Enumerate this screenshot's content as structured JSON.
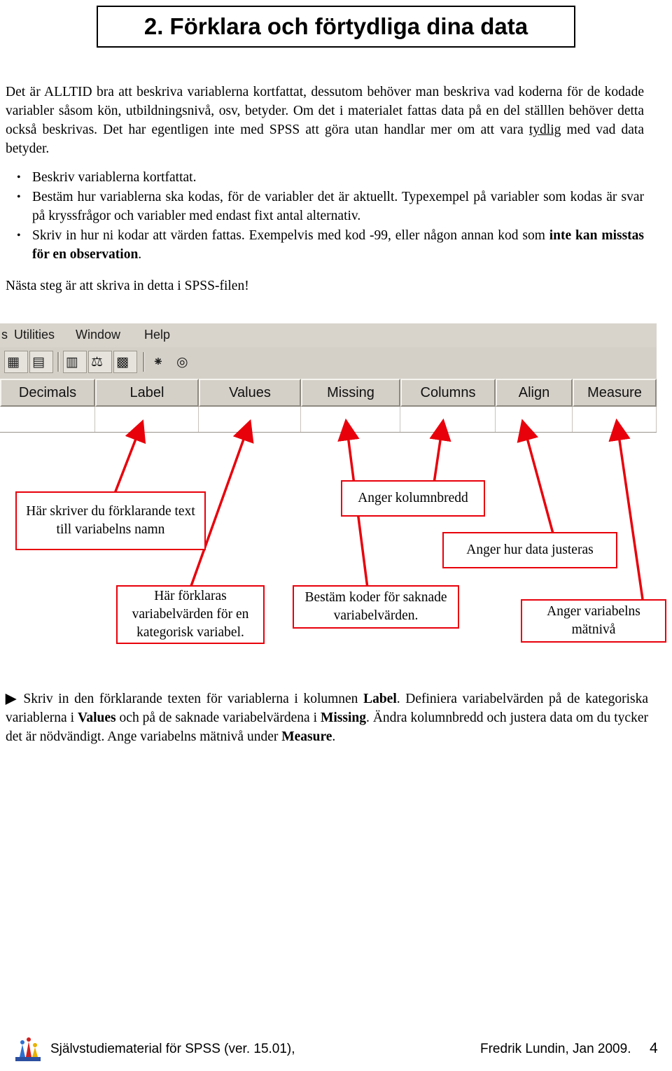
{
  "document": {
    "title": "2. Förklara och förtydliga dina data",
    "intro_html": "Det är ALLTID bra att beskriva variablerna kortfattat, dessutom behöver man beskriva vad koderna för de kodade variabler såsom kön, utbildningsnivå, osv, betyder. Om det i materialet fattas data på en del ställlen behöver detta också beskrivas. Det har egentligen inte med SPSS att göra utan handlar mer om att vara <u>tydlig</u> med vad data betyder.",
    "bullets": [
      "Beskriv variablerna kortfattat.",
      "Bestäm hur variablerna ska kodas, för de variabler det är aktuellt. Typexempel på variabler som kodas är svar på kryssfrågor och variabler med endast fixt antal alternativ.",
      "Skriv in hur ni kodar att värden fattas. Exempelvis med kod -99, eller någon annan kod som <b>inte kan misstas för en observation</b>."
    ],
    "next_step": "Nästa steg är att skriva in detta i SPSS-filen!",
    "instruction_html": "<b>▶</b> Skriv in den förklarande texten för variablerna i kolumnen <b>Label</b>. Definiera variabelvärden på de kategoriska variablerna i <b>Values</b> och på de saknade variabelvärdena i <b>Missing</b>. Ändra kolumnbredd och justera data om du tycker det är nödvändigt. Ange variabelns mätnivå under <b>Measure</b>."
  },
  "spss": {
    "menu": [
      {
        "label": "s"
      },
      {
        "label": "Utilities"
      },
      {
        "label": "Window"
      },
      {
        "label": "Help"
      }
    ],
    "toolbar_icons": [
      {
        "name": "insert-variable-icon",
        "glyph": "▦"
      },
      {
        "name": "insert-case-icon",
        "glyph": "▤"
      },
      {
        "name": "split-file-icon",
        "glyph": "▥"
      },
      {
        "name": "weight-cases-icon",
        "glyph": "⚖"
      },
      {
        "name": "select-cases-icon",
        "glyph": "▩"
      },
      {
        "name": "value-labels-icon",
        "glyph": "⁕"
      },
      {
        "name": "use-sets-icon",
        "glyph": "◎"
      }
    ],
    "columns": [
      {
        "label": "Decimals"
      },
      {
        "label": "Label"
      },
      {
        "label": "Values"
      },
      {
        "label": "Missing"
      },
      {
        "label": "Columns"
      },
      {
        "label": "Align"
      },
      {
        "label": "Measure"
      }
    ]
  },
  "callouts": [
    {
      "name": "callout-label",
      "text": "Här skriver du förklarande text till variabelns namn"
    },
    {
      "name": "callout-columns",
      "text": "Anger kolumnbredd"
    },
    {
      "name": "callout-align",
      "text": "Anger hur data justeras"
    },
    {
      "name": "callout-values",
      "text": "Här förklaras variabelvärden för en kategorisk variabel."
    },
    {
      "name": "callout-missing",
      "text": "Bestäm koder för saknade variabelvärden."
    },
    {
      "name": "callout-measure",
      "text": "Anger variabelns mätnivå"
    }
  ],
  "footer": {
    "left": "Självstudiematerial för SPSS (ver. 15.01),",
    "right": "Fredrik Lundin, Jan 2009.",
    "page": "4"
  },
  "colors": {
    "callout_border": "#e8000b",
    "spss_chrome": "#d4d0c8"
  }
}
